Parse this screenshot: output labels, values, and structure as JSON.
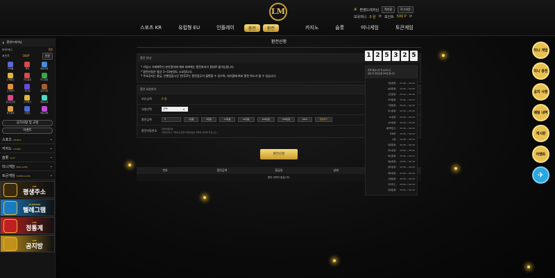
{
  "header": {
    "logo": "LM",
    "user_name": "환영드레저님",
    "btn_message": "쪽지함",
    "btn_logout": "로그아웃",
    "holding_label": "보유머니",
    "holding_value": "0 원",
    "point_label": "포인트",
    "point_value": "500 P"
  },
  "nav": {
    "items": [
      "스포츠 KR",
      "유럽형 EU",
      "인플레이"
    ],
    "pill1": "충전",
    "pill2": "환전",
    "items2": [
      "카지노",
      "슬롯",
      "미니게임",
      "토큰게임"
    ]
  },
  "sidebar": {
    "user": "환영드레저님",
    "holding_label": "보유머니",
    "holding_value": "0원",
    "point_label": "포인트",
    "point_value": "500P",
    "convert_label": "전환",
    "grid": [
      {
        "label": "마이룸",
        "color": "#5a6ad8"
      },
      {
        "label": "쪽지",
        "color": "#d94a4a"
      },
      {
        "label": "배팅내역",
        "color": "#4a8ad9"
      },
      {
        "label": "출석체크",
        "color": "#e0b53c"
      },
      {
        "label": "머니충전",
        "color": "#d94a4a"
      },
      {
        "label": "머니환전",
        "color": "#3aa64a"
      },
      {
        "label": "고객센터",
        "color": "#e09040"
      },
      {
        "label": "게시판",
        "color": "#6a4ad9"
      },
      {
        "label": "공지사항",
        "color": "#a06030"
      },
      {
        "label": "포인트전환",
        "color": "#d94a8a"
      },
      {
        "label": "출석체크",
        "color": "#e0b53c"
      },
      {
        "label": "배팅규정",
        "color": "#4ad9c0"
      },
      {
        "label": "경기결과",
        "color": "#d9a04a"
      },
      {
        "label": "이벤트",
        "color": "#4a6ad9"
      },
      {
        "label": "배팅내역",
        "color": "#c04ad9"
      }
    ],
    "btn_notice": "공지사항 및 규정",
    "btn_event": "이벤트",
    "cats": [
      {
        "label": "스포츠",
        "sub": "SPORTS"
      },
      {
        "label": "카지노",
        "sub": "CASINO"
      },
      {
        "label": "슬롯",
        "sub": "SLOT"
      },
      {
        "label": "미니게임",
        "sub": "MINI GAME"
      },
      {
        "label": "토큰게임",
        "sub": "TOKEN GAME"
      }
    ],
    "banners": [
      {
        "title": "평생주소",
        "sub": "LIM",
        "color": "#3a2a10"
      },
      {
        "title": "텔레그램",
        "sub": "@LIM2200",
        "color": "#1a7bc0"
      },
      {
        "title": "정통계",
        "sub": "LIM",
        "color": "#c02020"
      },
      {
        "title": "공지방",
        "sub": "LIM",
        "color": "#c0901a"
      }
    ]
  },
  "main": {
    "title": "환전신청",
    "notice_header": "환전 안내",
    "notes": [
      "* 가입시 기재해주신 본인명의에 계좌 외에에는 환전처리가 절대로 불가능합니다.",
      "* 환전신청은 평균 3~10분정도 소요됩니다.",
      "* 주요공지는 환금, 은행점검시간 전/후로는 환전업무가 불편할 수 있으며, 대기할때 최초 환전 취소가 될 수 있습니다."
    ],
    "form_header": "환전 요청하기",
    "label_holding": "보유금액",
    "holding_value": "0 원",
    "label_bank": "유형선택",
    "bank_select": "선택",
    "label_amount": "환전금액",
    "amount_value": "0",
    "chips": [
      "1만원",
      "5만원",
      "10만원",
      "50만원",
      "100만원",
      "300만원",
      "MAX",
      "정정하기"
    ],
    "label_pw": "환전비밀번호",
    "pw_hint": "환전비밀번호",
    "pw_note": "(회원가입시 기재하신 환전 비밀번호를 정확히 입력해 주십시오.)",
    "submit": "환전신청",
    "table_headers": [
      "번호",
      "환전금액",
      "환금일",
      "상태",
      "처리일"
    ],
    "empty": "환전 내역이 없습니다."
  },
  "rightpanel": {
    "digits": [
      "1",
      "2",
      "5",
      "3",
      "2",
      "5"
    ],
    "note1": "은행 점검시간 및 보내시고",
    "note2": "환전 후 환전신청 부탁드립니다.",
    "schedule": [
      [
        "국민은행 :",
        "23:40 ~ 00:30"
      ],
      [
        "농협은행 :",
        "23:30 ~ 00:30"
      ],
      [
        "신한은행 :",
        "23:30 ~ 00:30"
      ],
      [
        "우리은행 :",
        "23:40 ~ 00:10"
      ],
      [
        "기업은행 :",
        "00:00 ~ 00:30"
      ],
      [
        "하나은행 :",
        "23:50 ~ 00:10"
      ],
      [
        "SC은행 :",
        "23:30 ~ 00:30"
      ],
      [
        "씨티은행 :",
        "23:40 ~ 00:20"
      ],
      [
        "새마을금고 :",
        "23:30 ~ 00:30"
      ],
      [
        "우체국 :",
        "23:45 ~ 00:15"
      ],
      [
        "수협 :",
        "23:30 ~ 00:10"
      ],
      [
        "외환은행 :",
        "23:30 ~ 00:30"
      ],
      [
        "대구은행 :",
        "23:50 ~ 00:20"
      ],
      [
        "부산은행 :",
        "23:40 ~ 00:10"
      ],
      [
        "경남은행 :",
        "23:50 ~ 00:10"
      ],
      [
        "광주은행 :",
        "23:30 ~ 00:20"
      ],
      [
        "제주은행 :",
        "23:50 ~ 00:30"
      ],
      [
        "산업은행 :",
        "23:30 ~ 00:30"
      ],
      [
        "우리카드 :",
        "23:00 ~ 00:10"
      ],
      [
        "전북은행 :",
        "23:50 ~ 00:10"
      ]
    ]
  },
  "floats": [
    "미니 게임",
    "미니 충전",
    "공지 사항",
    "베팅 내역",
    "게시판",
    "이벤트",
    "✈"
  ]
}
